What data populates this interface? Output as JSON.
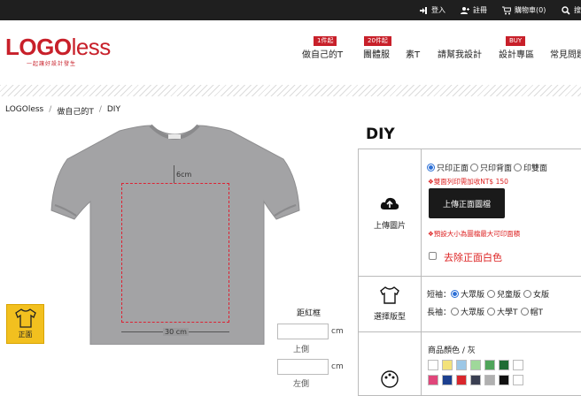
{
  "topbar": {
    "login": "登入",
    "register": "註冊",
    "cart": "購物車(0)",
    "search": "搜"
  },
  "logo": {
    "main_bold": "LOGO",
    "main_thin": "less",
    "sub": "一起讓好設計發生"
  },
  "nav": [
    {
      "label": "做自己的T",
      "badge": "1件起"
    },
    {
      "label": "團體服",
      "badge": "20件起"
    },
    {
      "label": "素T",
      "badge": ""
    },
    {
      "label": "請幫我設計",
      "badge": ""
    },
    {
      "label": "設計專區",
      "badge": "BUY"
    },
    {
      "label": "常見問題",
      "badge": ""
    }
  ],
  "breadcrumb": [
    "LOGOless",
    "做自己的T",
    "DIY"
  ],
  "shirt": {
    "dim_top": "6cm",
    "dim_width": "30 cm",
    "view_label": "正面",
    "margin_title": "距紅框",
    "unit": "cm",
    "side_top": "上側",
    "side_left": "左側"
  },
  "panel": {
    "title": "DIY",
    "upload_label": "上傳圖片",
    "print_options": [
      "只印正面",
      "只印背面",
      "印雙面"
    ],
    "double_note": "❖雙面列印需加收NT$ 150",
    "upload_button": "上傳正面圖檔",
    "size_note": "❖預設大小為圖檔最大可印面積",
    "remove_white": "去除正面白色",
    "style_label": "選擇版型",
    "short_sleeve": "短袖：",
    "short_options": [
      "大眾版",
      "兒童版",
      "女版"
    ],
    "long_sleeve": "長袖：",
    "long_options": [
      "大眾版",
      "大學T",
      "帽T"
    ],
    "color_title": "商品顏色 / 灰",
    "colors": [
      "#ffffff",
      "#f3e27a",
      "#9cc7e6",
      "#9fd89a",
      "#4fa45a",
      "#1f6b34",
      "#ffffff",
      "#e0467a",
      "#1c3f8f",
      "#d9262c",
      "#3a3f52",
      "#b0b0b0",
      "#111111",
      "#ffffff"
    ]
  }
}
